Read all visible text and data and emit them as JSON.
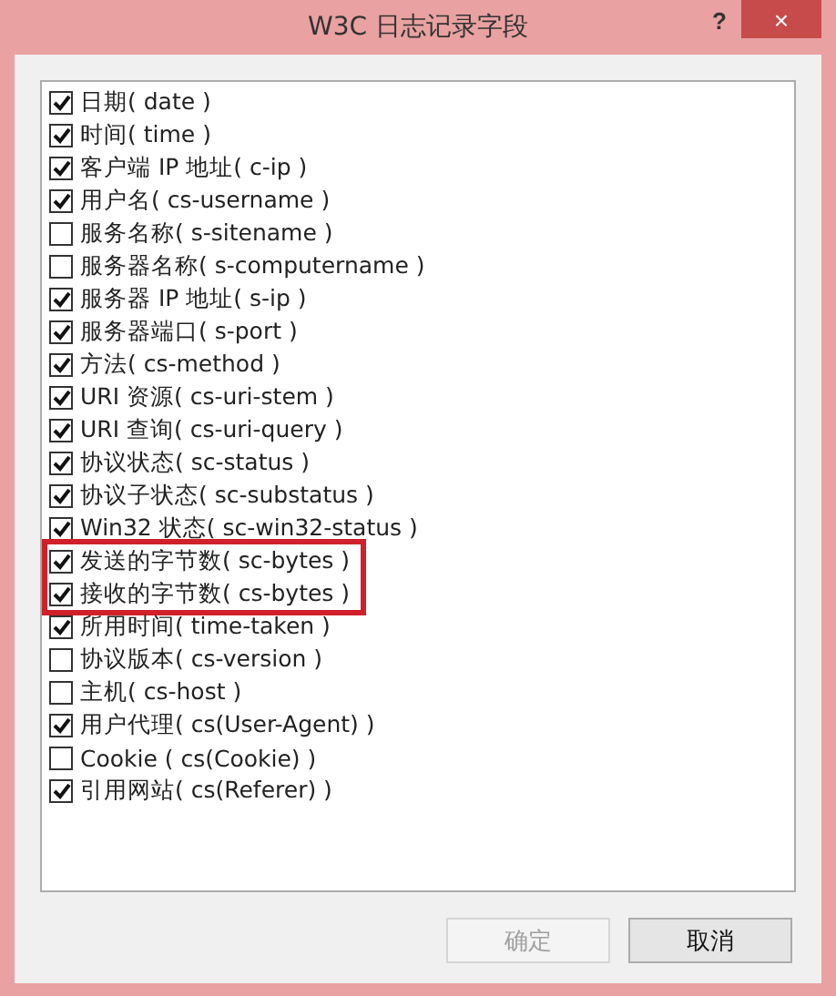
{
  "window": {
    "title": "W3C 日志记录字段",
    "help": "?",
    "close": "×"
  },
  "fields": [
    {
      "label": "日期( date )",
      "checked": true,
      "highlighted": false
    },
    {
      "label": "时间( time )",
      "checked": true,
      "highlighted": false
    },
    {
      "label": "客户端 IP 地址( c-ip )",
      "checked": true,
      "highlighted": false
    },
    {
      "label": "用户名( cs-username )",
      "checked": true,
      "highlighted": false
    },
    {
      "label": "服务名称( s-sitename )",
      "checked": false,
      "highlighted": false
    },
    {
      "label": "服务器名称( s-computername )",
      "checked": false,
      "highlighted": false
    },
    {
      "label": "服务器 IP 地址( s-ip )",
      "checked": true,
      "highlighted": false
    },
    {
      "label": "服务器端口( s-port )",
      "checked": true,
      "highlighted": false
    },
    {
      "label": "方法( cs-method )",
      "checked": true,
      "highlighted": false
    },
    {
      "label": "URI 资源( cs-uri-stem )",
      "checked": true,
      "highlighted": false
    },
    {
      "label": "URI 查询( cs-uri-query )",
      "checked": true,
      "highlighted": false
    },
    {
      "label": "协议状态( sc-status )",
      "checked": true,
      "highlighted": false
    },
    {
      "label": "协议子状态( sc-substatus )",
      "checked": true,
      "highlighted": false
    },
    {
      "label": "Win32 状态( sc-win32-status )",
      "checked": true,
      "highlighted": false
    },
    {
      "label": "发送的字节数( sc-bytes )",
      "checked": true,
      "highlighted": true
    },
    {
      "label": "接收的字节数( cs-bytes )",
      "checked": true,
      "highlighted": true
    },
    {
      "label": "所用时间( time-taken )",
      "checked": true,
      "highlighted": false
    },
    {
      "label": "协议版本( cs-version )",
      "checked": false,
      "highlighted": false
    },
    {
      "label": "主机( cs-host )",
      "checked": false,
      "highlighted": false
    },
    {
      "label": "用户代理( cs(User-Agent) )",
      "checked": true,
      "highlighted": false
    },
    {
      "label": "Cookie ( cs(Cookie) )",
      "checked": false,
      "highlighted": false
    },
    {
      "label": "引用网站( cs(Referer) )",
      "checked": true,
      "highlighted": false
    }
  ],
  "buttons": [
    {
      "label": "确定",
      "disabled": true
    },
    {
      "label": "取消",
      "disabled": false
    }
  ]
}
